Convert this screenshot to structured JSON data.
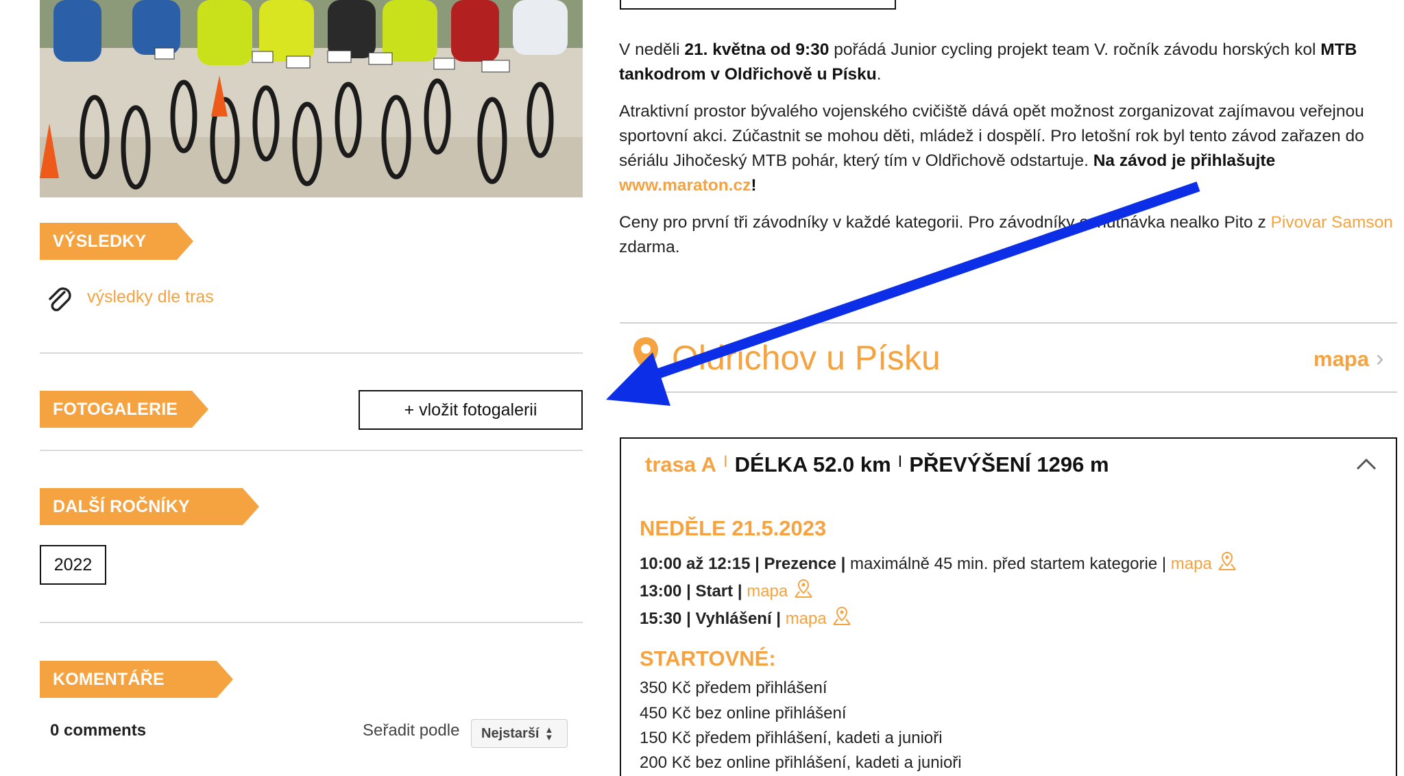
{
  "left": {
    "results": {
      "heading": "VÝSLEDKY",
      "link": "výsledky dle tras",
      "icon": "paperclip-icon"
    },
    "gallery": {
      "heading": "FOTOGALERIE",
      "add_button": "+ vložit fotogalerii"
    },
    "years": {
      "heading": "DALŠÍ ROČNÍKY",
      "items": [
        "2022"
      ]
    },
    "comments": {
      "heading": "KOMENTÁŘE",
      "count": "0 comments",
      "sort_label": "Seřadit podle",
      "sort_value": "Nejstarší"
    }
  },
  "right": {
    "intro": {
      "p1": {
        "t1": "V neděli ",
        "b1": "21. května od 9:30",
        "t2": " pořádá Junior cycling projekt team V. ročník závodu horských kol ",
        "b2": "MTB tankodrom v Oldřichově u Písku",
        "t3": "."
      },
      "p2": {
        "t1": "Atraktivní prostor bývalého vojenského cvičiště dává opět možnost zorganizovat zajímavou veřejnou sportovní akci. Zúčastnit se mohou děti, mládež i dospělí. Pro letošní rok byl tento závod zařazen do sériálu Jihočeský MTB pohár, který tím v Oldřichově odstartuje. ",
        "b1": "Na závod je přihlašujte ",
        "link": "www.maraton.cz",
        "b2": "!"
      },
      "p3": {
        "t1": "Ceny pro první tři závodníky v každé kategorii. Pro závodníky ochutnávka nealko Pito z ",
        "link": "Pivovar Samson",
        "t2": " zdarma."
      }
    },
    "location": {
      "name": "Oldřichov u Písku",
      "map_link": "mapa",
      "icon": "map-pin-icon"
    },
    "route": {
      "name": "trasa A",
      "sep": "I",
      "length": "DÉLKA 52.0 km",
      "elevation": "PŘEVÝŠENÍ 1296 m",
      "date_heading": "NEDĚLE 21.5.2023",
      "schedule": [
        {
          "time": "10:00 až 12:15",
          "title": "Prezence",
          "note": "maximálně 45 min. před startem kategorie",
          "map": "mapa"
        },
        {
          "time": "13:00",
          "title": "Start",
          "note": "",
          "map": "mapa"
        },
        {
          "time": "15:30",
          "title": "Vyhlášení",
          "note": "",
          "map": "mapa"
        }
      ],
      "fees_heading": "STARTOVNÉ:",
      "fees": [
        "350 Kč předem přihlášení",
        "450 Kč bez online přihlášení",
        "150 Kč předem přihlášení, kadeti a junioři",
        "200 Kč bez online přihlášení, kadeti a junioři"
      ]
    }
  },
  "colors": {
    "accent": "#f4a340",
    "annotation_arrow": "#0b2ee6"
  }
}
